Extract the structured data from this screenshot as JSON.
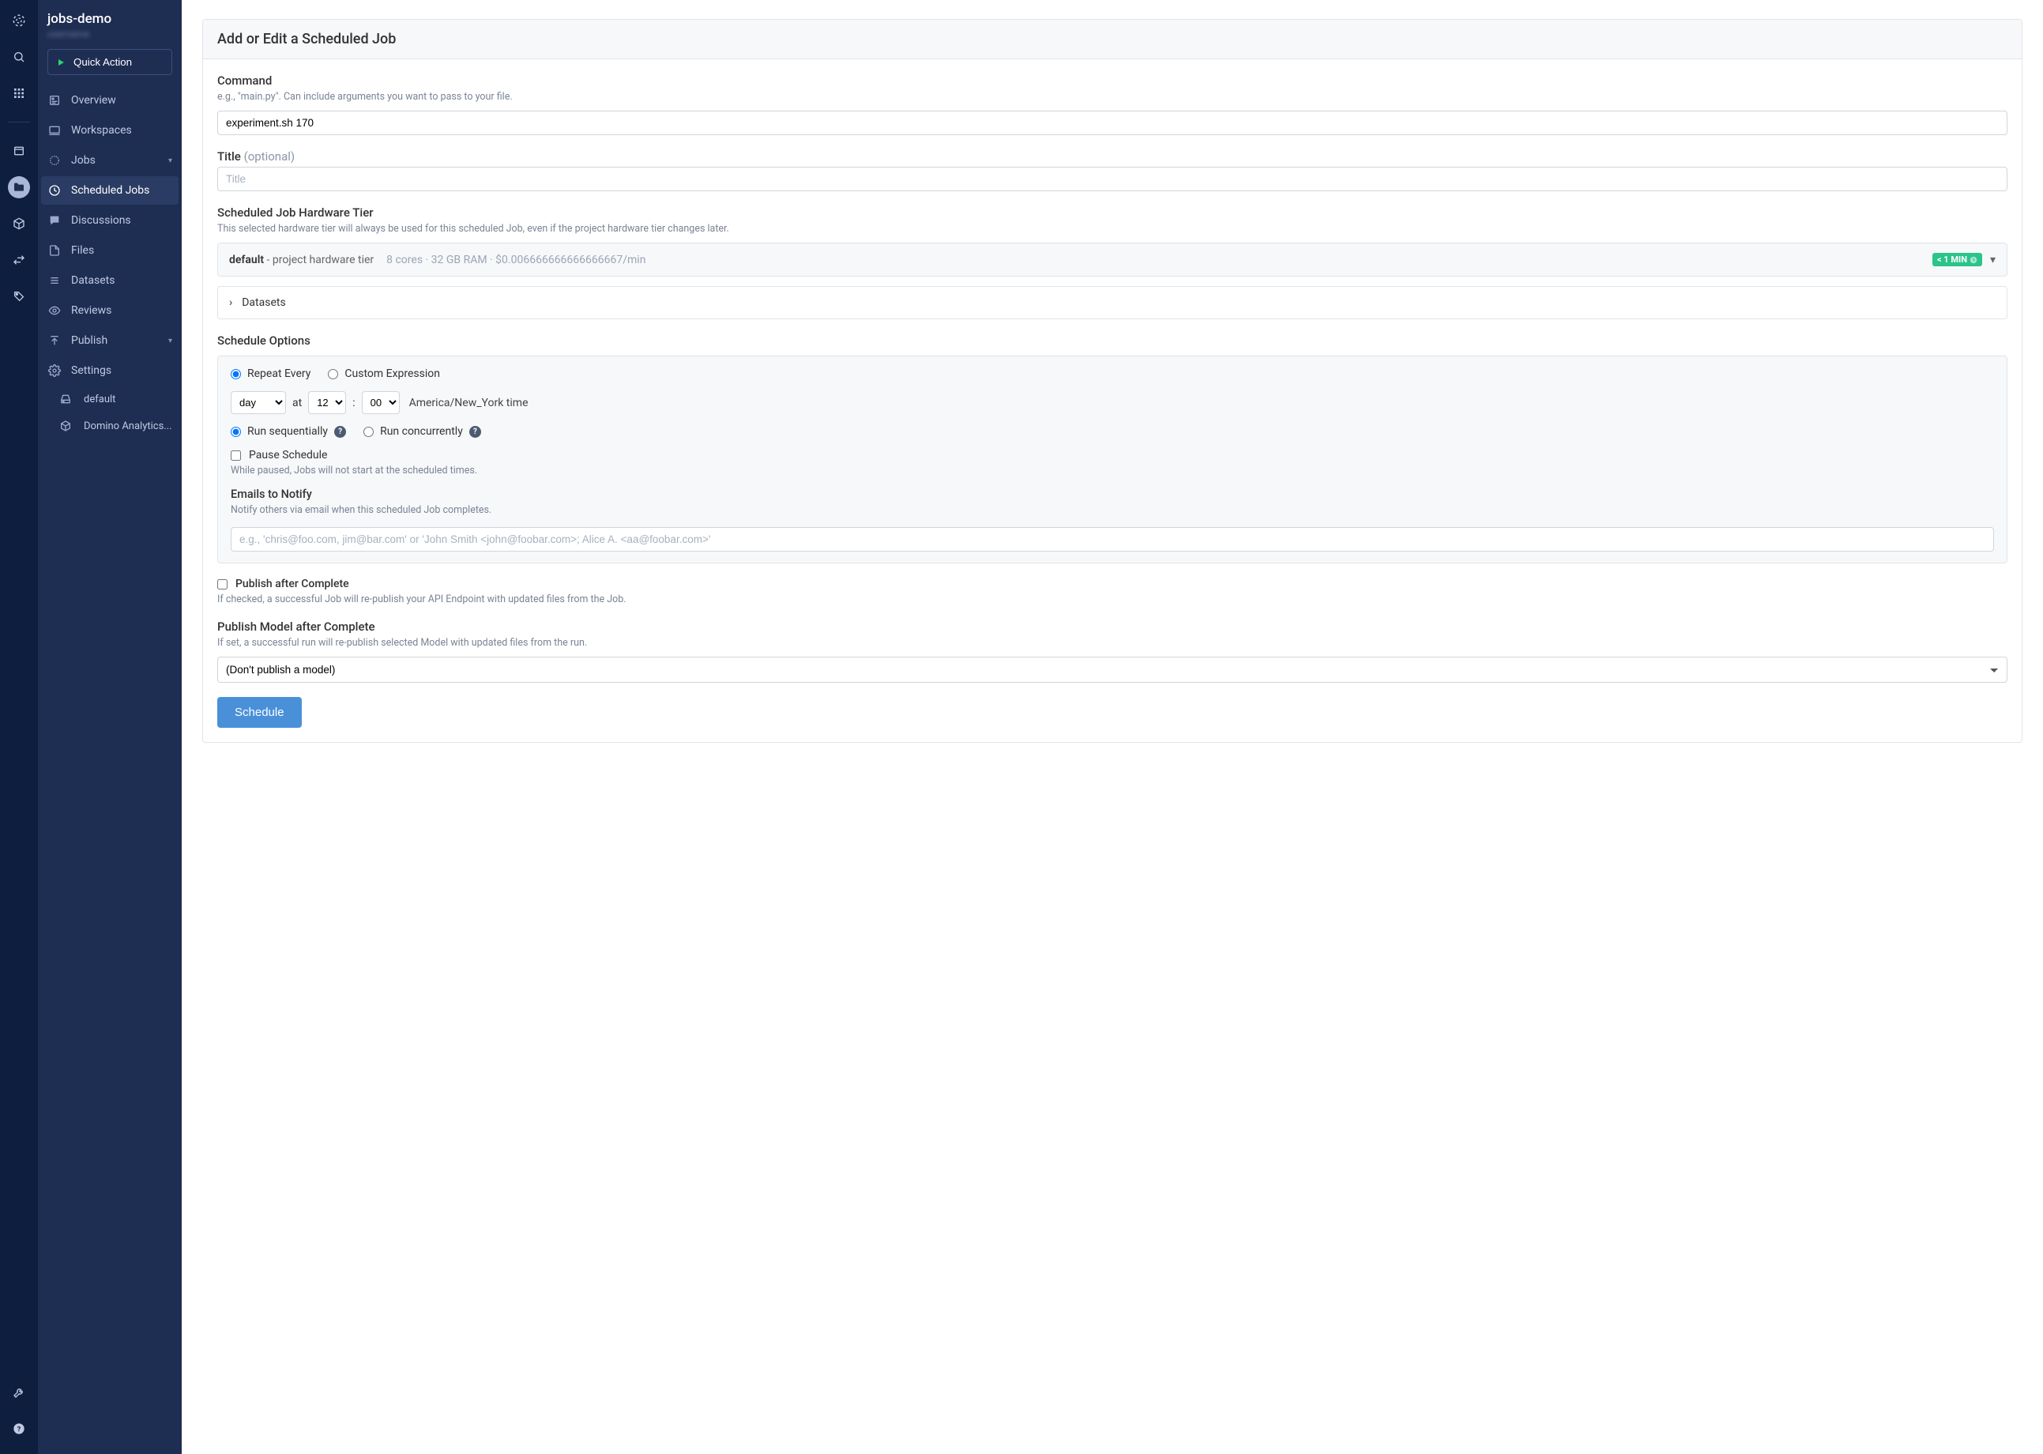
{
  "project": {
    "title": "jobs-demo",
    "subtitle": "username"
  },
  "quick_action_label": "Quick Action",
  "sidebar": {
    "items": [
      {
        "label": "Overview"
      },
      {
        "label": "Workspaces"
      },
      {
        "label": "Jobs"
      },
      {
        "label": "Scheduled Jobs"
      },
      {
        "label": "Discussions"
      },
      {
        "label": "Files"
      },
      {
        "label": "Datasets"
      },
      {
        "label": "Reviews"
      },
      {
        "label": "Publish"
      },
      {
        "label": "Settings"
      }
    ],
    "sub_items": [
      {
        "label": "default"
      },
      {
        "label": "Domino Analytics..."
      }
    ]
  },
  "page": {
    "title": "Add or Edit a Scheduled Job",
    "command": {
      "label": "Command",
      "help": "e.g., \"main.py\". Can include arguments you want to pass to your file.",
      "value": "experiment.sh 170"
    },
    "title_field": {
      "label": "Title",
      "optional": "(optional)",
      "placeholder": "Title"
    },
    "hw": {
      "label": "Scheduled Job Hardware Tier",
      "help": "This selected hardware tier will always be used for this scheduled Job, even if the project hardware tier changes later.",
      "name": "default",
      "desc": " - project hardware tier",
      "specs": "8 cores · 32 GB RAM · $0.006666666666666667/min",
      "badge": "< 1 MIN"
    },
    "datasets_label": "Datasets",
    "schedule": {
      "header": "Schedule Options",
      "repeat_every": "Repeat Every",
      "custom_expr": "Custom Expression",
      "unit": "day",
      "at_text": "at",
      "hour": "12",
      "colon": ":",
      "minute": "00",
      "tz": "America/New_York time",
      "run_seq": "Run sequentially",
      "run_conc": "Run concurrently",
      "pause_label": "Pause Schedule",
      "pause_help": "While paused, Jobs will not start at the scheduled times.",
      "emails_label": "Emails to Notify",
      "emails_help": "Notify others via email when this scheduled Job completes.",
      "emails_placeholder": "e.g., 'chris@foo.com, jim@bar.com' or 'John Smith <john@foobar.com>; Alice A. <aa@foobar.com>'"
    },
    "publish": {
      "check_label": "Publish after Complete",
      "check_help": "If checked, a successful Job will re-publish your API Endpoint with updated files from the Job.",
      "model_label": "Publish Model after Complete",
      "model_help": "If set, a successful run will re-publish selected Model with updated files from the run.",
      "model_selected": "(Don't publish a model)"
    },
    "submit": "Schedule"
  }
}
